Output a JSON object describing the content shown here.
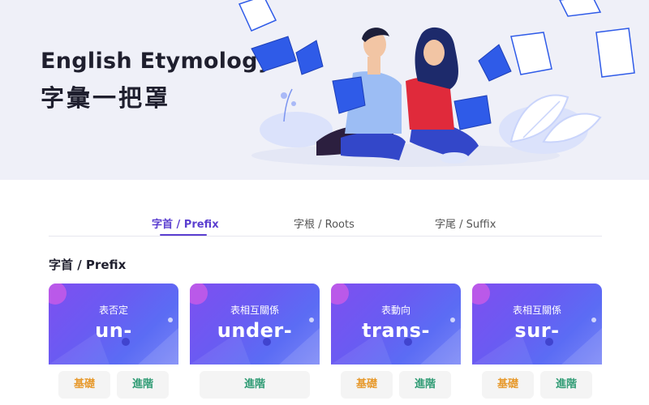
{
  "hero": {
    "title": "English Etymology",
    "subtitle": "字彙一把罩"
  },
  "tabs": [
    {
      "label": "字首 / Prefix",
      "active": true
    },
    {
      "label": "字根 / Roots",
      "active": false
    },
    {
      "label": "字尾 / Suffix",
      "active": false
    }
  ],
  "section": {
    "title": "字首 / Prefix"
  },
  "cards": [
    {
      "meaning": "表否定",
      "word": "un-",
      "buttons": [
        {
          "label": "基礎",
          "kind": "basic"
        },
        {
          "label": "進階",
          "kind": "advanced"
        }
      ]
    },
    {
      "meaning": "表相互關係",
      "word": "under-",
      "buttons": [
        {
          "label": "進階",
          "kind": "advanced"
        }
      ]
    },
    {
      "meaning": "表動向",
      "word": "trans-",
      "buttons": [
        {
          "label": "基礎",
          "kind": "basic"
        },
        {
          "label": "進階",
          "kind": "advanced"
        }
      ]
    },
    {
      "meaning": "表相互關係",
      "word": "sur-",
      "buttons": [
        {
          "label": "基礎",
          "kind": "basic"
        },
        {
          "label": "進階",
          "kind": "advanced"
        }
      ]
    }
  ],
  "colors": {
    "accent": "#5b3fd0",
    "basic": "#e79a2e",
    "advanced": "#2f9b74",
    "card_gradient_start": "#7e4ff0",
    "card_gradient_end": "#7a86f6"
  },
  "hero_art": "two-people-reading-books-illustration"
}
